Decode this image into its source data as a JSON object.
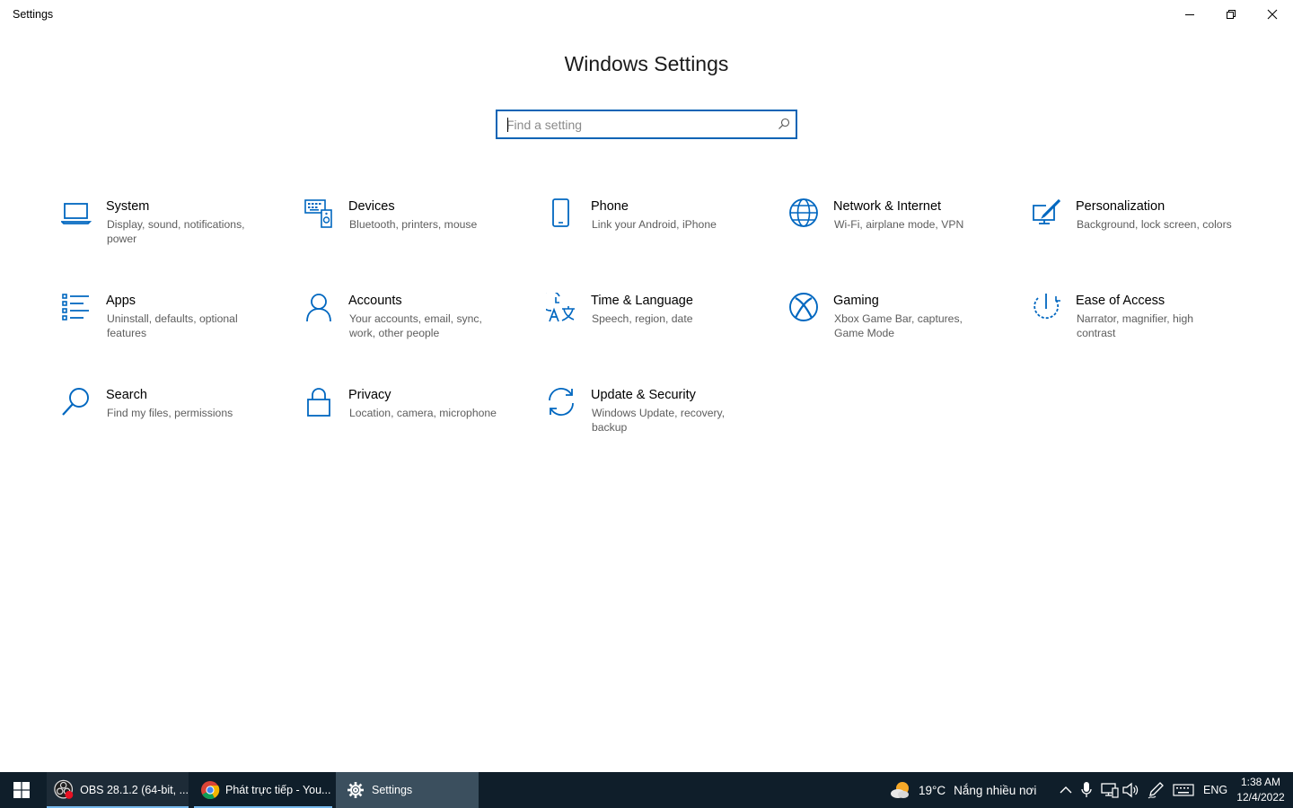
{
  "window": {
    "title": "Settings",
    "controls": [
      "minimize-icon",
      "maximize-icon",
      "close-icon"
    ]
  },
  "header": {
    "title": "Windows Settings"
  },
  "search": {
    "placeholder": "Find a setting",
    "value": "",
    "icon": "search-icon"
  },
  "accent_color": "#0067c0",
  "categories": [
    {
      "label": "System",
      "description": "Display, sound, notifications, power",
      "icon": "laptop-icon"
    },
    {
      "label": "Devices",
      "description": "Bluetooth, printers, mouse",
      "icon": "devices-icon"
    },
    {
      "label": "Phone",
      "description": "Link your Android, iPhone",
      "icon": "phone-icon"
    },
    {
      "label": "Network & Internet",
      "description": "Wi-Fi, airplane mode, VPN",
      "icon": "globe-icon"
    },
    {
      "label": "Personalization",
      "description": "Background, lock screen, colors",
      "icon": "paintbrush-icon"
    },
    {
      "label": "Apps",
      "description": "Uninstall, defaults, optional features",
      "icon": "apps-list-icon"
    },
    {
      "label": "Accounts",
      "description": "Your accounts, email, sync, work, other people",
      "icon": "person-icon"
    },
    {
      "label": "Time & Language",
      "description": "Speech, region, date",
      "icon": "time-language-icon"
    },
    {
      "label": "Gaming",
      "description": "Xbox Game Bar, captures, Game Mode",
      "icon": "xbox-icon"
    },
    {
      "label": "Ease of Access",
      "description": "Narrator, magnifier, high contrast",
      "icon": "ease-of-access-icon"
    },
    {
      "label": "Search",
      "description": "Find my files, permissions",
      "icon": "search-icon"
    },
    {
      "label": "Privacy",
      "description": "Location, camera, microphone",
      "icon": "lock-icon"
    },
    {
      "label": "Update & Security",
      "description": "Windows Update, recovery, backup",
      "icon": "sync-icon"
    }
  ],
  "taskbar": {
    "start_icon": "windows-logo-icon",
    "items": [
      {
        "label": "OBS 28.1.2 (64-bit, ...",
        "icon": "obs-icon"
      },
      {
        "label": "Phát trực tiếp - You...",
        "icon": "chrome-icon"
      },
      {
        "label": "Settings",
        "icon": "gear-icon"
      }
    ],
    "weather": {
      "temperature": "19°C",
      "condition": "Nắng nhiều nơi",
      "icon": "weather-sun-cloud-icon"
    },
    "tray_icons": [
      "chevron-up-icon",
      "microphone-icon",
      "network-icon",
      "speaker-icon",
      "pen-icon",
      "keyboard-icon"
    ],
    "language": "ENG",
    "time": "1:38 AM",
    "date": "12/4/2022"
  }
}
